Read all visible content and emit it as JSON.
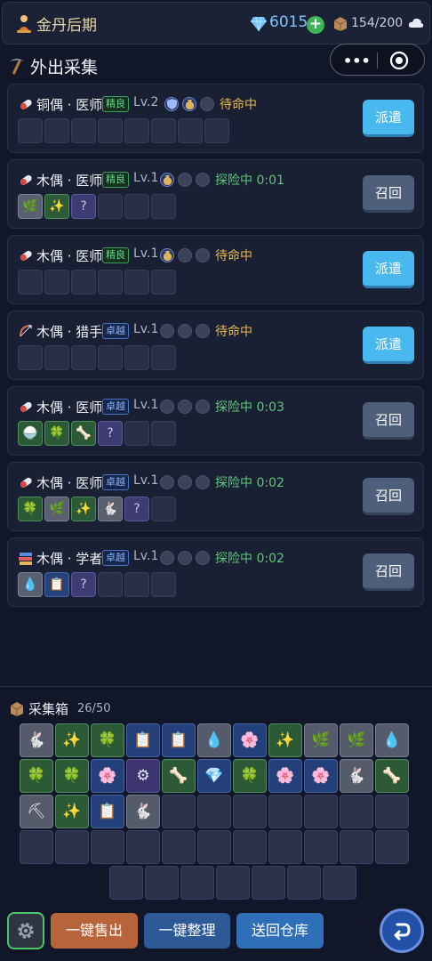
{
  "topbar": {
    "stage_icon": "meditating-figure-icon",
    "stage_name": "金丹后期",
    "gems": "6015",
    "add_label": "+",
    "capacity": "154/200"
  },
  "section": {
    "title": "外出采集"
  },
  "capsule": {
    "dots": "•••"
  },
  "cards": [
    {
      "role_icon": "pill-icon",
      "name": "铜偶 · 医师",
      "badge": "精良",
      "badge_type": "good",
      "level": "Lv.2",
      "status": "待命中",
      "status_type": "idle",
      "button": "派遣",
      "button_type": "dispatch"
    },
    {
      "role_icon": "pill-icon",
      "name": "木偶 · 医师",
      "badge": "精良",
      "badge_type": "good",
      "level": "Lv.1",
      "status": "探险中 0:01",
      "status_type": "busy",
      "button": "召回",
      "button_type": "recall"
    },
    {
      "role_icon": "pill-icon",
      "name": "木偶 · 医师",
      "badge": "精良",
      "badge_type": "good",
      "level": "Lv.1",
      "status": "待命中",
      "status_type": "idle",
      "button": "派遣",
      "button_type": "dispatch"
    },
    {
      "role_icon": "bow-icon",
      "name": "木偶 · 猎手",
      "badge": "卓越",
      "badge_type": "epic",
      "level": "Lv.1",
      "status": "待命中",
      "status_type": "idle",
      "button": "派遣",
      "button_type": "dispatch"
    },
    {
      "role_icon": "pill-icon",
      "name": "木偶 · 医师",
      "badge": "卓越",
      "badge_type": "epic",
      "level": "Lv.1",
      "status": "探险中 0:03",
      "status_type": "busy",
      "button": "召回",
      "button_type": "recall"
    },
    {
      "role_icon": "pill-icon",
      "name": "木偶 · 医师",
      "badge": "卓越",
      "badge_type": "epic",
      "level": "Lv.1",
      "status": "探险中 0:02",
      "status_type": "busy",
      "button": "召回",
      "button_type": "recall"
    },
    {
      "role_icon": "books-icon",
      "name": "木偶 · 学者",
      "badge": "卓越",
      "badge_type": "epic",
      "level": "Lv.1",
      "status": "探险中 0:02",
      "status_type": "busy",
      "button": "召回",
      "button_type": "recall"
    }
  ],
  "card_slots": [
    [
      "",
      "",
      "",
      "",
      "",
      "",
      "",
      ""
    ],
    [
      "🌿|gray",
      "✨|green",
      "?|purple",
      "",
      "",
      ""
    ],
    [
      "",
      "",
      "",
      "",
      "",
      ""
    ],
    [
      "",
      "",
      "",
      "",
      "",
      ""
    ],
    [
      "🍚|green",
      "🍀|green",
      "🦴|green",
      "?|purple",
      "",
      ""
    ],
    [
      "🍀|green",
      "🌿|gray",
      "✨|green",
      "🐇|gray",
      "?|purple",
      ""
    ],
    [
      "💧|gray",
      "📋|blue",
      "?|purple",
      "",
      "",
      ""
    ]
  ],
  "card_buffs": [
    [
      "shield",
      "money-bag",
      "empty"
    ],
    [
      "money-bag",
      "empty",
      "empty"
    ],
    [
      "money-bag",
      "empty",
      "empty"
    ],
    [
      "empty",
      "empty",
      "empty"
    ],
    [
      "empty",
      "empty",
      "empty"
    ],
    [
      "empty",
      "empty",
      "empty"
    ],
    [
      "empty",
      "empty",
      "empty"
    ]
  ],
  "storage": {
    "title": "采集箱",
    "count": "26/50",
    "rows": [
      [
        "🐇|gray",
        "✨|green",
        "🍀|green",
        "📋|blue",
        "📋|blue",
        "💧|gray",
        "🌸|blue",
        "✨|green",
        "🌿|gray",
        "🌿|gray",
        "💧|gray"
      ],
      [
        "🍀|green",
        "🍀|green",
        "🌸|blue",
        "⚙|purple",
        "🦴|green",
        "💎|blue",
        "🍀|green",
        "🌸|blue",
        "🌸|blue",
        "🐇|gray",
        "🦴|green"
      ],
      [
        "⛏|gray",
        "✨|green",
        "📋|blue",
        "🐇|gray",
        "",
        "",
        "",
        "",
        "",
        "",
        ""
      ],
      [
        "",
        "",
        "",
        "",
        "",
        "",
        "",
        "",
        "",
        "",
        ""
      ],
      [
        "",
        "",
        "",
        "",
        "",
        "",
        ""
      ]
    ]
  },
  "actions": {
    "sell": "一键售出",
    "sort": "一键整理",
    "return": "送回仓库"
  }
}
